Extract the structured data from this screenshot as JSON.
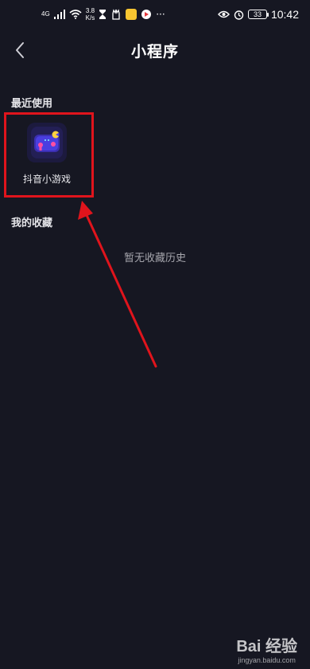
{
  "status_bar": {
    "signal_text": "4G",
    "net_speed_value": "3.8",
    "net_speed_unit": "K/s",
    "more": "···",
    "battery": "33",
    "time": "10:42"
  },
  "header": {
    "title": "小程序"
  },
  "recent": {
    "section_title": "最近使用",
    "items": [
      {
        "label": "抖音小游戏",
        "icon": "game-controller-icon"
      }
    ]
  },
  "favorites": {
    "section_title": "我的收藏",
    "empty_text": "暂无收藏历史"
  },
  "colors": {
    "background": "#161722",
    "annotation_red": "#e0141c",
    "muted_text": "#a6a6ad"
  },
  "watermark": {
    "logo_text": "Bai 经验",
    "url": "jingyan.baidu.com"
  }
}
